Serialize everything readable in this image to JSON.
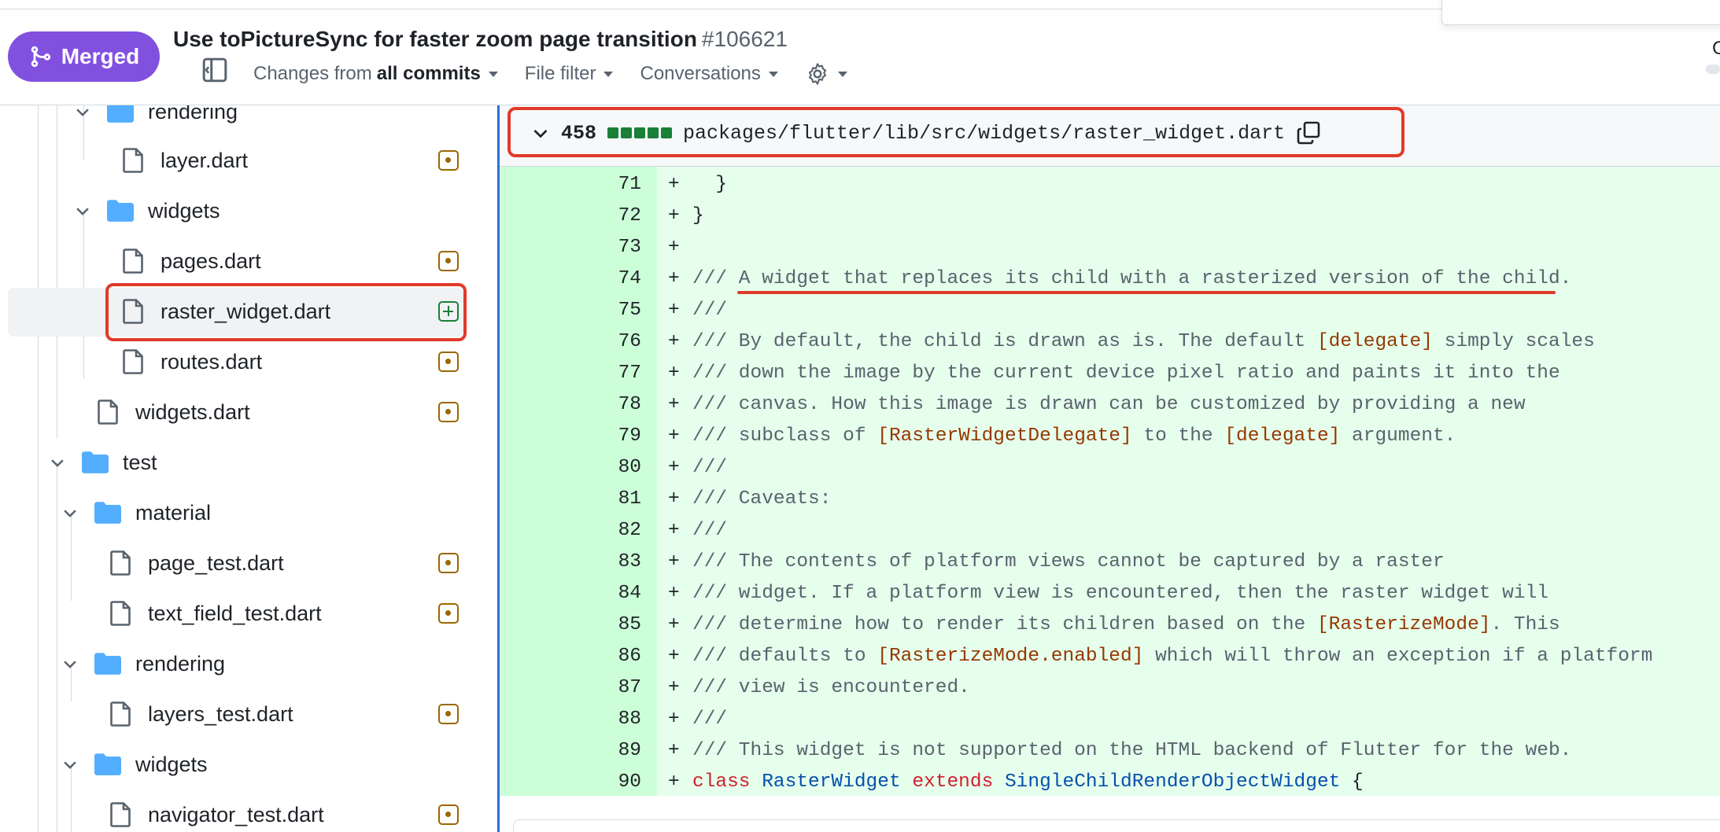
{
  "header": {
    "status_badge": "Merged",
    "title": "Use toPictureSync for faster zoom page transition",
    "pr_number": "#106621",
    "changes_prefix": "Changes from",
    "changes_value": "all commits",
    "file_filter": "File filter",
    "conversations": "Conversations",
    "edge_char": "C"
  },
  "sidebar": {
    "rendering_folder": "rendering",
    "layer_file": "layer.dart",
    "widgets_folder": "widgets",
    "pages_file": "pages.dart",
    "raster_widget_file": "raster_widget.dart",
    "routes_file": "routes.dart",
    "widgets_file": "widgets.dart",
    "test_folder": "test",
    "material_folder": "material",
    "page_test_file": "page_test.dart",
    "text_field_test_file": "text_field_test.dart",
    "test_rendering_folder": "rendering",
    "layers_test_file": "layers_test.dart",
    "test_widgets_folder": "widgets",
    "navigator_test_file": "navigator_test.dart"
  },
  "file_header": {
    "changes_count": "458",
    "path": "packages/flutter/lib/src/widgets/raster_widget.dart"
  },
  "diff": {
    "sign": "+",
    "lines": [
      {
        "num": "71",
        "parts": [
          {
            "t": "  }",
            "c": "plain"
          }
        ]
      },
      {
        "num": "72",
        "parts": [
          {
            "t": "}",
            "c": "plain"
          }
        ]
      },
      {
        "num": "73",
        "parts": [
          {
            "t": "",
            "c": "plain"
          }
        ]
      },
      {
        "num": "74",
        "parts": [
          {
            "t": "/// A widget that replaces its child with a rasterized version of the child.",
            "c": "comment"
          }
        ]
      },
      {
        "num": "75",
        "parts": [
          {
            "t": "///",
            "c": "comment"
          }
        ]
      },
      {
        "num": "76",
        "parts": [
          {
            "t": "/// By default, the child is drawn as is. The default ",
            "c": "comment"
          },
          {
            "t": "[delegate]",
            "c": "ref"
          },
          {
            "t": " simply scales",
            "c": "comment"
          }
        ]
      },
      {
        "num": "77",
        "parts": [
          {
            "t": "/// down the image by the current device pixel ratio and paints it into the",
            "c": "comment"
          }
        ]
      },
      {
        "num": "78",
        "parts": [
          {
            "t": "/// canvas. How this image is drawn can be customized by providing a new",
            "c": "comment"
          }
        ]
      },
      {
        "num": "79",
        "parts": [
          {
            "t": "/// subclass of ",
            "c": "comment"
          },
          {
            "t": "[RasterWidgetDelegate]",
            "c": "ref"
          },
          {
            "t": " to the ",
            "c": "comment"
          },
          {
            "t": "[delegate]",
            "c": "ref"
          },
          {
            "t": " argument.",
            "c": "comment"
          }
        ]
      },
      {
        "num": "80",
        "parts": [
          {
            "t": "///",
            "c": "comment"
          }
        ]
      },
      {
        "num": "81",
        "parts": [
          {
            "t": "/// Caveats:",
            "c": "comment"
          }
        ]
      },
      {
        "num": "82",
        "parts": [
          {
            "t": "///",
            "c": "comment"
          }
        ]
      },
      {
        "num": "83",
        "parts": [
          {
            "t": "/// The contents of platform views cannot be captured by a raster",
            "c": "comment"
          }
        ]
      },
      {
        "num": "84",
        "parts": [
          {
            "t": "/// widget. If a platform view is encountered, then the raster widget will",
            "c": "comment"
          }
        ]
      },
      {
        "num": "85",
        "parts": [
          {
            "t": "/// determine how to render its children based on the ",
            "c": "comment"
          },
          {
            "t": "[RasterizeMode]",
            "c": "ref"
          },
          {
            "t": ". This",
            "c": "comment"
          }
        ]
      },
      {
        "num": "86",
        "parts": [
          {
            "t": "/// defaults to ",
            "c": "comment"
          },
          {
            "t": "[RasterizeMode.enabled]",
            "c": "ref"
          },
          {
            "t": " which will throw an exception if a platform",
            "c": "comment"
          }
        ]
      },
      {
        "num": "87",
        "parts": [
          {
            "t": "/// view is encountered.",
            "c": "comment"
          }
        ]
      },
      {
        "num": "88",
        "parts": [
          {
            "t": "///",
            "c": "comment"
          }
        ]
      },
      {
        "num": "89",
        "parts": [
          {
            "t": "/// This widget is not supported on the HTML backend of Flutter for the web.",
            "c": "comment"
          }
        ]
      },
      {
        "num": "90",
        "parts": [
          {
            "t": "class",
            "c": "kw"
          },
          {
            "t": " ",
            "c": "plain"
          },
          {
            "t": "RasterWidget",
            "c": "type"
          },
          {
            "t": " ",
            "c": "plain"
          },
          {
            "t": "extends",
            "c": "kw"
          },
          {
            "t": " ",
            "c": "plain"
          },
          {
            "t": "SingleChildRenderObjectWidget",
            "c": "type"
          },
          {
            "t": " {",
            "c": "plain"
          }
        ]
      }
    ]
  },
  "colors": {
    "merged": "#8250df",
    "highlight": "#e03a2a",
    "added_bg": "#e6ffec",
    "added_num_bg": "#ccffd8",
    "modified": "#9a6700",
    "added": "#1a7f37"
  }
}
